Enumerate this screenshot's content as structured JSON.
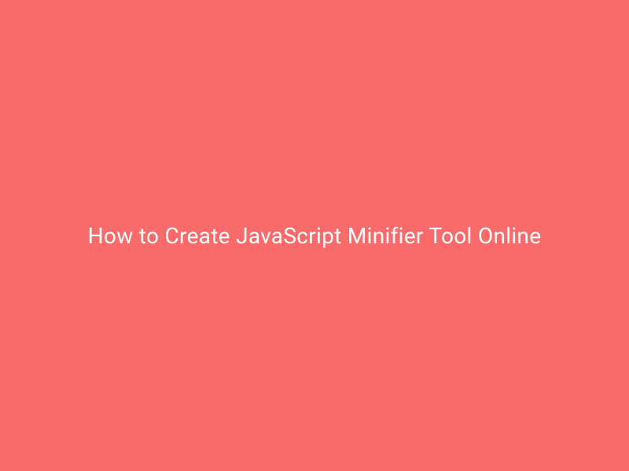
{
  "title": "How to Create JavaScript Minifier Tool Online"
}
